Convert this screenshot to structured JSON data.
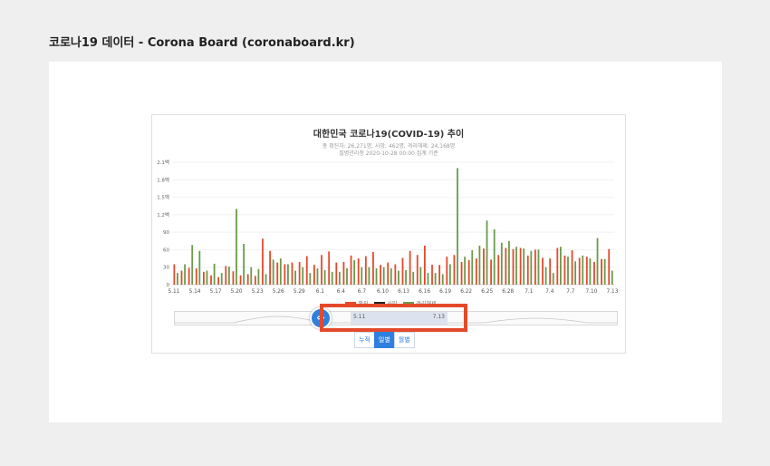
{
  "page": {
    "title": "코로나19 데이터 - Corona Board (coronaboard.kr)"
  },
  "chart_data": {
    "type": "bar",
    "title": "대한민국 코로나19(COVID-19) 추이",
    "subtitle_line1": "총 확진자: 26,271명, 사망: 462명, 격리해제: 24,168명",
    "subtitle_line2": "질병관리청 2020-10-28 00:00 집계 기준",
    "y_tick_labels": [
      "0",
      "30",
      "60",
      "90",
      "1.2백",
      "1.5백",
      "1.8백",
      "2.1백"
    ],
    "y_ticks": [
      0,
      30,
      60,
      90,
      120,
      150,
      180,
      210
    ],
    "ylim": [
      0,
      210
    ],
    "x_tick_labels": [
      "5.11",
      "5.14",
      "5.17",
      "5.20",
      "5.23",
      "5.26",
      "5.29",
      "6.1",
      "6.4",
      "6.7",
      "6.10",
      "6.13",
      "6.16",
      "6.19",
      "6.22",
      "6.25",
      "6.28",
      "7.1",
      "7.4",
      "7.7",
      "7.10",
      "7.13"
    ],
    "grid": true,
    "series": [
      {
        "name": "확진",
        "color": "#e4492b",
        "values": [
          35,
          24,
          29,
          28,
          22,
          16,
          13,
          32,
          23,
          16,
          18,
          15,
          79,
          58,
          38,
          35,
          38,
          39,
          49,
          34,
          51,
          57,
          38,
          39,
          50,
          45,
          49,
          56,
          34,
          38,
          35,
          46,
          58,
          51,
          67,
          34,
          34,
          48,
          51,
          39,
          42,
          45,
          62,
          43,
          51,
          63,
          61,
          63,
          50,
          60,
          46,
          45,
          63,
          50,
          59,
          46,
          48,
          39,
          44,
          61
        ]
      },
      {
        "name": "사망",
        "color": "#222222",
        "values": [
          0,
          0,
          0,
          0,
          0,
          0,
          0,
          0,
          0,
          0,
          0,
          0,
          0,
          0,
          0,
          0,
          0,
          0,
          0,
          0,
          0,
          0,
          0,
          0,
          0,
          0,
          0,
          0,
          0,
          0,
          0,
          0,
          0,
          0,
          0,
          0,
          0,
          0,
          0,
          0,
          0,
          0,
          0,
          0,
          0,
          0,
          0,
          0,
          0,
          0,
          0,
          0,
          0,
          0,
          0,
          0,
          0,
          0,
          0,
          0
        ]
      },
      {
        "name": "격리해제",
        "color": "#6a9a4a",
        "values": [
          20,
          35,
          68,
          58,
          24,
          36,
          20,
          31,
          130,
          70,
          30,
          27,
          18,
          43,
          45,
          35,
          24,
          30,
          20,
          28,
          25,
          22,
          22,
          28,
          42,
          30,
          30,
          28,
          30,
          28,
          24,
          25,
          22,
          30,
          20,
          20,
          18,
          35,
          200,
          48,
          59,
          67,
          110,
          95,
          72,
          75,
          65,
          62,
          58,
          60,
          30,
          20,
          65,
          48,
          40,
          50,
          45,
          80,
          44,
          24
        ]
      }
    ],
    "legend_position": "bottom",
    "navigator": {
      "range_start": "5.11",
      "range_end": "7.13"
    }
  },
  "view_toggle": {
    "options": [
      "누적",
      "일별",
      "월별"
    ],
    "selected": "일별"
  },
  "colors": {
    "accent": "#2f7fe0",
    "highlight": "#e4492b",
    "confirmed": "#e4492b",
    "death": "#222222",
    "released": "#6a9a4a"
  }
}
